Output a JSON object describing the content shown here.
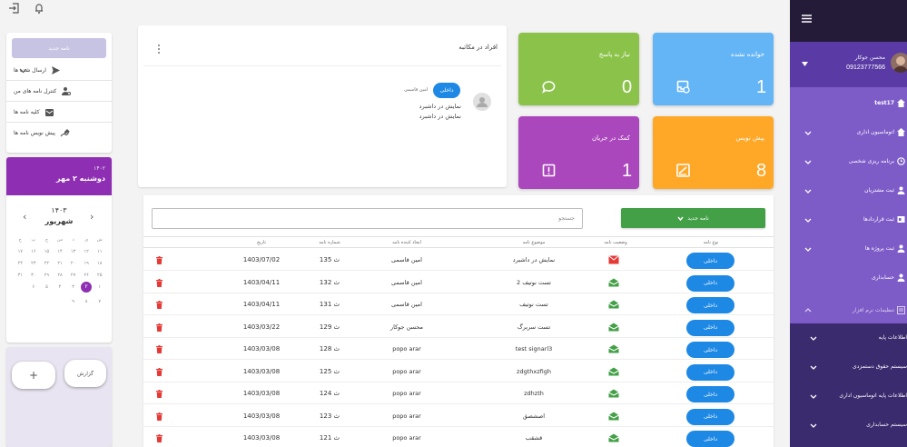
{
  "topbar": {
    "icons": [
      "logout-icon",
      "bell-icon"
    ]
  },
  "left_panel": {
    "new_letter_label": "نامه جدید",
    "items": [
      {
        "label": "ارسال شده ها",
        "icon": "send-icon"
      },
      {
        "label": "کنترل نامه های من",
        "icon": "user-settings-icon"
      },
      {
        "label": "کلیه نامه ها",
        "icon": "mail-box-icon"
      },
      {
        "label": "پیش نویس نامه ها",
        "icon": "draft-icon"
      }
    ]
  },
  "calendar": {
    "header_year": "۱۴۰۲",
    "header_date": "دوشنبه ۲ مهر",
    "year": "۱۴۰۳",
    "month": "شهریور",
    "weekdays": [
      "ش",
      "ی",
      "د",
      "س",
      "چ",
      "پ",
      "ج"
    ],
    "days": [
      "",
      "",
      "",
      "",
      "",
      "",
      "",
      "۱۱",
      "۱۲",
      "۱۳",
      "۱۴",
      "۱۵",
      "۱۶",
      "۱۷",
      "۱۸",
      "۱۹",
      "۲۰",
      "۲۱",
      "۲۲",
      "۲۳",
      "۲۴",
      "۲۵",
      "۲۶",
      "۲۷",
      "۲۸",
      "۲۹",
      "۳۰",
      "۳۱",
      "۱",
      "۲",
      "۳",
      "۴",
      "۵",
      "۶",
      "",
      "۷",
      "۸",
      "۹",
      "",
      "",
      "",
      ""
    ],
    "selected_day": "۲",
    "accent": "#8e2fb3"
  },
  "action_box": {
    "button_left": "+",
    "button_right": "گزارش"
  },
  "cartable": {
    "title": "افراد در مکاتبه",
    "message": {
      "badge": "داخلی",
      "sender": "امین قاسمی",
      "lines": [
        "نمایش در داشبرد",
        "نمایش در داشبرد"
      ]
    }
  },
  "tiles": [
    {
      "label": "نیاز به پاسخ",
      "value": "0",
      "color": "#8bc34a",
      "icon": "chat-bubble-icon"
    },
    {
      "label": "خوانده نشده",
      "value": "1",
      "color": "#64b5f6",
      "icon": "inbox-clock-icon"
    },
    {
      "label": "کمک در جریان",
      "value": "1",
      "color": "#ab47bc",
      "icon": "alert-box-icon"
    },
    {
      "label": "پیش نویس",
      "value": "8",
      "color": "#ffa726",
      "icon": "draft-icon"
    }
  ],
  "table": {
    "search_placeholder": "جستجو",
    "new_button": "نامه جدید",
    "headers": {
      "type": "نوع نامه",
      "status": "وضعیت نامه",
      "subject": "موضوع نامه",
      "creator": "ایجاد کننده نامه",
      "number": "شماره نامه",
      "date": "تاریخ"
    },
    "rows": [
      {
        "type": "داخلی",
        "status": "unread",
        "subject": "نمایش در داشبرد",
        "creator": "امین قاسمی",
        "number": "135 ث",
        "date": "1403/07/02"
      },
      {
        "type": "داخلی",
        "status": "read",
        "subject": "تست نوتیف 2",
        "creator": "امین قاسمی",
        "number": "132 ث",
        "date": "1403/04/11"
      },
      {
        "type": "داخلی",
        "status": "read",
        "subject": "تست نوتیف",
        "creator": "امین قاسمی",
        "number": "131 ث",
        "date": "1403/04/11"
      },
      {
        "type": "داخلی",
        "status": "read",
        "subject": "تست سربرگ",
        "creator": "محسن جوکار",
        "number": "129 ث",
        "date": "1403/03/22"
      },
      {
        "type": "داخلی",
        "status": "read",
        "subject": "test signarl3",
        "creator": "popo arar",
        "number": "128 ث",
        "date": "1403/03/08"
      },
      {
        "type": "داخلی",
        "status": "read",
        "subject": "zdgthxzfigh",
        "creator": "popo arar",
        "number": "125 ث",
        "date": "1403/03/08"
      },
      {
        "type": "داخلی",
        "status": "read",
        "subject": "zdhzth",
        "creator": "popo arar",
        "number": "124 ث",
        "date": "1403/03/08"
      },
      {
        "type": "داخلی",
        "status": "read",
        "subject": "اصشصق",
        "creator": "popo arar",
        "number": "123 ث",
        "date": "1403/03/08"
      },
      {
        "type": "داخلی",
        "status": "read",
        "subject": "قشقب",
        "creator": "popo arar",
        "number": "121 ث",
        "date": "1403/03/08"
      }
    ]
  },
  "sidebar": {
    "user_name": "محسن جوکار",
    "user_phone": "09123777566",
    "items": [
      {
        "label": "test17",
        "icon": "home-icon",
        "chevron": false
      },
      {
        "label": "اتوماسیون اداری",
        "icon": "home-icon",
        "chevron": true
      },
      {
        "label": "برنامه ریزی شخصی",
        "icon": "clock-icon",
        "chevron": true
      },
      {
        "label": "ثبت مشتریان",
        "icon": "person-icon",
        "chevron": true
      },
      {
        "label": "ثبت قراردادها",
        "icon": "contract-icon",
        "chevron": true
      },
      {
        "label": "ثبت پروژه ها",
        "icon": "person-icon",
        "chevron": true
      },
      {
        "label": "حسابداری",
        "icon": "person-icon",
        "chevron": false
      },
      {
        "label": "تنظیمات نرم افزار",
        "icon": "settings-doc-icon",
        "chevron": true
      }
    ],
    "sub_items": [
      {
        "label": "اطلاعات پایه"
      },
      {
        "label": "سیستم حقوق دستمزدی"
      },
      {
        "label": "اطلاعات پایه اتوماسیون اداری"
      },
      {
        "label": "سیستم حسابداری"
      }
    ]
  }
}
